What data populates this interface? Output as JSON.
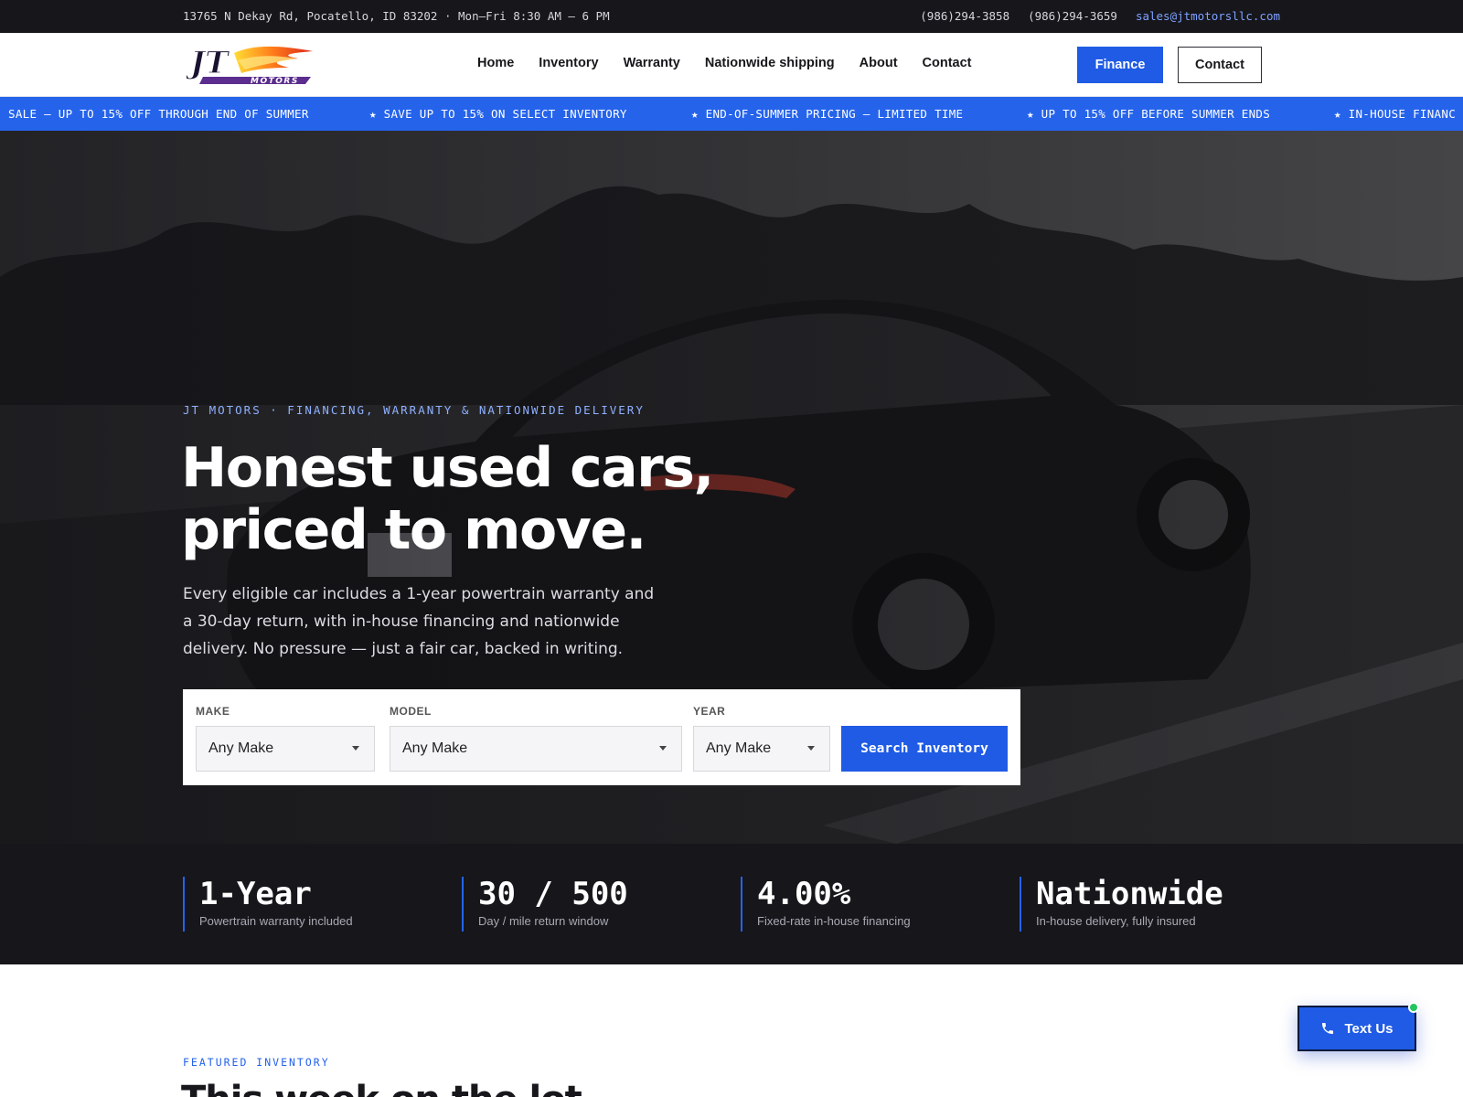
{
  "topbar": {
    "address": "13765 N Dekay Rd, Pocatello, ID 83202 · Mon–Fri 8:30 AM – 6 PM",
    "phone1": "(986)294-3858",
    "phone2": "(986)294-3659",
    "email": "sales@jtmotorsllc.com"
  },
  "header": {
    "logo_text_top": "JT",
    "logo_text_bottom": "MOTORS",
    "nav": [
      "Home",
      "Inventory",
      "Warranty",
      "Nationwide shipping",
      "About",
      "Contact"
    ],
    "finance_label": "Finance",
    "contact_label": "Contact"
  },
  "ticker": {
    "items": [
      "SALE — UP TO 15% OFF THROUGH END OF SUMMER",
      "★ SAVE UP TO 15% ON SELECT INVENTORY",
      "★ END-OF-SUMMER PRICING — LIMITED TIME",
      "★ UP TO 15% OFF BEFORE SUMMER ENDS",
      "★ IN-HOUSE FINANC"
    ]
  },
  "hero": {
    "eyebrow": "JT MOTORS · FINANCING, WARRANTY & NATIONWIDE DELIVERY",
    "headline_line1": "Honest used cars,",
    "headline_line2": "priced to move.",
    "lede": "Every eligible car includes a 1-year powertrain warranty and a 30-day return, with in-house financing and nationwide delivery. No pressure — just a fair car, backed in writing."
  },
  "search": {
    "make_label": "MAKE",
    "make_value": "Any Make",
    "model_label": "MODEL",
    "model_value": "Any Make",
    "year_label": "YEAR",
    "year_value": "Any Make",
    "button_label": "Search Inventory"
  },
  "stats": [
    {
      "value": "1-Year",
      "label": "Powertrain warranty included"
    },
    {
      "value": "30 / 500",
      "label": "Day / mile return window"
    },
    {
      "value": "4.00%",
      "label": "Fixed-rate in-house financing"
    },
    {
      "value": "Nationwide",
      "label": "In-house delivery, fully insured"
    }
  ],
  "featured": {
    "eyebrow": "FEATURED INVENTORY",
    "title": "This week on the lot"
  },
  "floating": {
    "text_us_label": "Text Us"
  },
  "colors": {
    "accent": "#1f5be5",
    "ticker": "#2563eb",
    "dark": "#16161b",
    "online_dot": "#22c55e"
  }
}
